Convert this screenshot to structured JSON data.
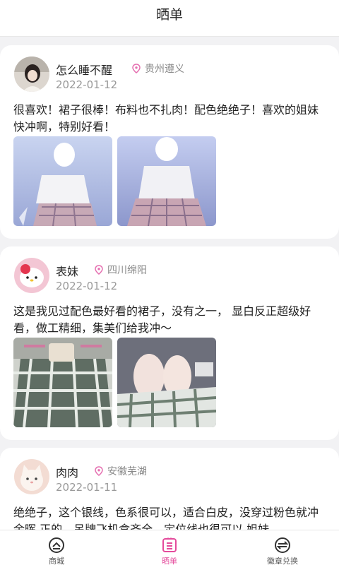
{
  "header": {
    "title": "晒单"
  },
  "posts": [
    {
      "username": "怎么睡不醒",
      "location": "贵州遵义",
      "date": "2022-01-12",
      "text": "很喜欢！裙子很棒！布料也不扎肉！配色绝绝子！喜欢的姐妹快冲啊，特别好看！"
    },
    {
      "username": "表妹",
      "location": "四川绵阳",
      "date": "2022-01-12",
      "text": "这是我见过配色最好看的裙子，没有之一， 显白反正超级好看，做工精细，集美们给我冲～"
    },
    {
      "username": "肉肉",
      "location": "安徽芜湖",
      "date": "2022-01-11",
      "text": "绝绝子，这个银线，色系很可以，适合白皮，没穿过粉色就冲余晖 正的，吊牌飞机盒齐全，定位线也很可以 姐妹"
    }
  ],
  "tabbar": {
    "items": [
      {
        "label": "商城",
        "icon": "shop-icon"
      },
      {
        "label": "晒单",
        "icon": "showcase-icon",
        "active": true
      },
      {
        "label": "徽章兑换",
        "icon": "badge-exchange-icon"
      }
    ]
  },
  "colors": {
    "accent": "#e44b9c",
    "location_pin": "#e56fb0",
    "background": "#f2f2f4"
  }
}
